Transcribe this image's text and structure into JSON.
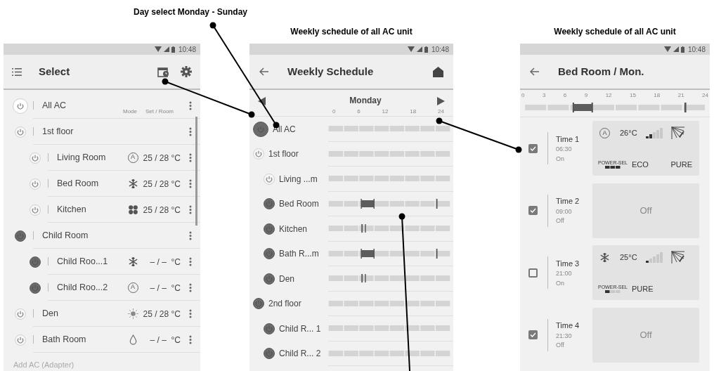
{
  "annotation": "Day select Monday - Sunday",
  "select_screen": {
    "status_time": "10:48",
    "title": "Select",
    "column_labels": [
      "Mode",
      "Set / Room"
    ],
    "all_row": {
      "name": "All AC",
      "power_on": false
    },
    "rows": [
      {
        "name": "1st floor",
        "power_on": false,
        "children": [
          {
            "name": "Living Room",
            "power_on": false,
            "mode_icon": {
              "kind": "auto",
              "letter": "A"
            },
            "setting": "25 / 28 °C"
          },
          {
            "name": "Bed Room",
            "power_on": false,
            "mode_icon": {
              "kind": "cool"
            },
            "setting": "25 / 28 °C"
          },
          {
            "name": "Kitchen",
            "power_on": false,
            "mode_icon": {
              "kind": "fan"
            },
            "setting": "25 / 28 °C"
          }
        ]
      },
      {
        "name": "Child Room",
        "power_on": true,
        "children": [
          {
            "name": "Child Roo...1",
            "power_on": true,
            "mode_icon": {
              "kind": "cool"
            },
            "setting": "– / –  °C"
          },
          {
            "name": "Child Roo...2",
            "power_on": true,
            "mode_icon": {
              "kind": "auto",
              "letter": "A"
            },
            "setting": "– / –  °C"
          }
        ]
      },
      {
        "name": "Den",
        "power_on": false,
        "mode_icon": {
          "kind": "heat"
        },
        "setting": "25 / 28 °C"
      },
      {
        "name": "Bath Room",
        "power_on": false,
        "mode_icon": {
          "kind": "dry"
        },
        "setting": "– / –  °C"
      }
    ],
    "footer": "Add AC (Adapter)"
  },
  "schedule_screen": {
    "caption": "Weekly schedule of all AC unit",
    "status_time": "10:48",
    "title": "Weekly Schedule",
    "day": "Monday",
    "ticks": [
      "0",
      "6",
      "12",
      "18",
      "24"
    ],
    "all_row": {
      "name": "All AC",
      "power_on": true,
      "timeline": {
        "kind": "empty"
      }
    },
    "rows": [
      {
        "name": "1st floor",
        "power_on": false,
        "timeline": {
          "kind": "empty"
        },
        "children": [
          {
            "name": "Living ...m",
            "power_on": false,
            "timeline": {
              "kind": "empty"
            }
          },
          {
            "name": "Bed Room",
            "power_on": true,
            "timeline": {
              "kind": "block"
            }
          },
          {
            "name": "Kitchen",
            "power_on": true,
            "timeline": {
              "kind": "ticks"
            }
          },
          {
            "name": "Bath R...m",
            "power_on": true,
            "timeline": {
              "kind": "block"
            }
          },
          {
            "name": "Den",
            "power_on": true,
            "timeline": {
              "kind": "ticks"
            }
          }
        ]
      },
      {
        "name": "2nd floor",
        "power_on": true,
        "timeline": {
          "kind": "empty"
        },
        "children": [
          {
            "name": "Child R... 1",
            "power_on": true,
            "timeline": {
              "kind": "empty"
            }
          },
          {
            "name": "Child R... 2",
            "power_on": true,
            "timeline": {
              "kind": "empty"
            }
          }
        ]
      }
    ]
  },
  "detail_screen": {
    "caption": "Weekly schedule of all AC unit",
    "status_time": "10:48",
    "title": "Bed Room / Mon.",
    "ticks": [
      "0",
      "3",
      "6",
      "9",
      "12",
      "15",
      "18",
      "21",
      "24"
    ],
    "timeline": {
      "kind": "block"
    },
    "entries": [
      {
        "checked": true,
        "label": "Time 1",
        "time": "06:30",
        "state": "On",
        "setting": {
          "mode_icon": {
            "kind": "auto",
            "letter": "A"
          },
          "temperature": "26°C",
          "fan_icon": {
            "kind": "strong"
          },
          "power_sel_label": "POWER-SEL",
          "power_sel_icon": {
            "kind": "strong"
          },
          "options": [
            "ECO",
            "PURE"
          ]
        }
      },
      {
        "checked": true,
        "label": "Time 2",
        "time": "09:00",
        "state": "Off",
        "card_text": "Off"
      },
      {
        "checked": false,
        "label": "Time 3",
        "time": "21:00",
        "state": "On",
        "setting": {
          "mode_icon": {
            "kind": "cool"
          },
          "temperature": "25°C",
          "fan_icon": {
            "kind": "weak"
          },
          "power_sel_label": "POWER-SEL",
          "power_sel_icon": {
            "kind": "weak"
          },
          "options": [
            "PURE"
          ]
        }
      },
      {
        "checked": true,
        "label": "Time 4",
        "time": "21:30",
        "state": "Off",
        "card_text": "Off"
      }
    ]
  }
}
